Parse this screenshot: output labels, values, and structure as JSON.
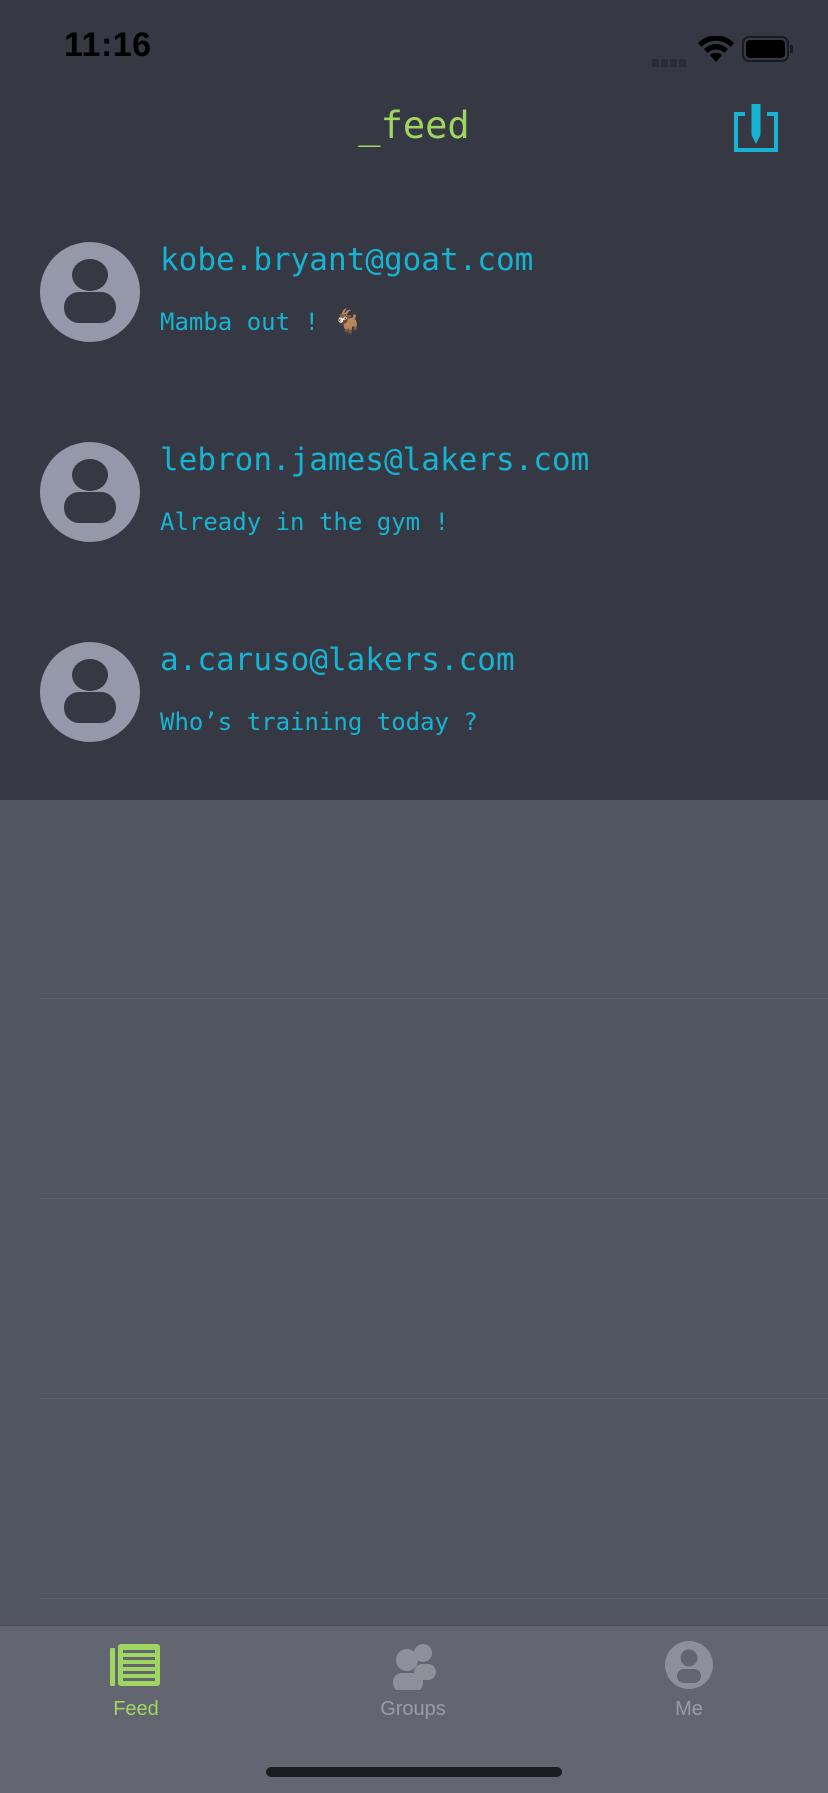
{
  "status_bar": {
    "time": "11:16"
  },
  "nav": {
    "title": "_feed",
    "compose_icon": "compose-icon"
  },
  "feed": {
    "posts": [
      {
        "email": "kobe.bryant@goat.com",
        "message": "Mamba out ! 🐐"
      },
      {
        "email": "lebron.james@lakers.com",
        "message": "Already in the gym !"
      },
      {
        "email": "a.caruso@lakers.com",
        "message": "Who’s training today ?"
      }
    ]
  },
  "tab_bar": {
    "tabs": [
      {
        "label": "Feed",
        "icon": "newspaper-icon",
        "active": true
      },
      {
        "label": "Groups",
        "icon": "people-icon",
        "active": false
      },
      {
        "label": "Me",
        "icon": "person-icon",
        "active": false
      }
    ]
  },
  "colors": {
    "accent_green": "#9fd65f",
    "accent_cyan": "#16b4d2",
    "header_bg": "#363843",
    "list_bg": "#525663",
    "tab_bar_bg": "#636670",
    "inactive_tab": "#9a9ca3"
  }
}
